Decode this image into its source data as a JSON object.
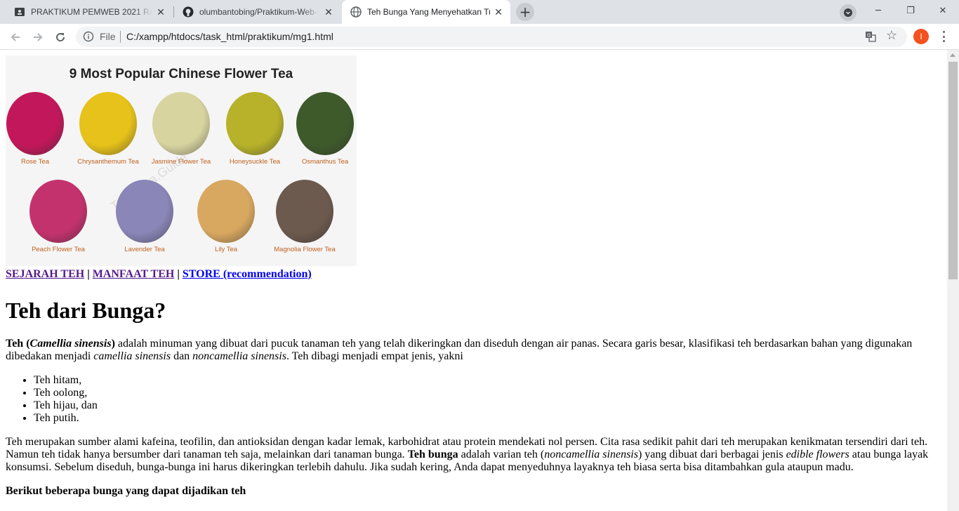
{
  "browser": {
    "tabs": [
      {
        "title": "PRAKTIKUM PEMWEB 2021 RA, R",
        "icon": "classroom-icon"
      },
      {
        "title": "olumbantobing/Praktikum-Web-",
        "icon": "github-icon"
      },
      {
        "title": "Teh Bunga Yang Menyehatkan Tu",
        "icon": "globe-icon"
      }
    ],
    "address": {
      "scheme_label": "File",
      "url": "C:/xampp/htdocs/task_html/praktikum/mg1.html"
    },
    "profile_initial": "I"
  },
  "poster": {
    "title": "9 Most Popular Chinese Flower Tea",
    "watermark": "TeaChina.Guide",
    "teas": [
      {
        "name": "Rose Tea",
        "color": "#c2185b"
      },
      {
        "name": "Chrysanthemum Tea",
        "color": "#e6c21a"
      },
      {
        "name": "Jasmine Flower Tea",
        "color": "#d8d4a0"
      },
      {
        "name": "Honeysuckle Tea",
        "color": "#b8b22a"
      },
      {
        "name": "Osmanthus Tea",
        "color": "#3e5a2a"
      },
      {
        "name": "Peach Flower Tea",
        "color": "#c4326e"
      },
      {
        "name": "Lavender Tea",
        "color": "#8a86b8"
      },
      {
        "name": "Lily Tea",
        "color": "#d9a860"
      },
      {
        "name": "Magnolia Flower Tea",
        "color": "#6d5a4e"
      }
    ]
  },
  "nav": {
    "sejarah": "SEJARAH TEH",
    "manfaat": "MANFAAT TEH",
    "store": "STORE (recommendation)",
    "separator": "|"
  },
  "page": {
    "title": "Teh dari Bunga?",
    "p1": {
      "b_teh": "Teh (",
      "bi_camellia": "Camellia sinensis",
      "b_close": ")",
      "t1": " adalah minuman yang dibuat dari pucuk tanaman teh yang telah dikeringkan dan diseduh dengan air panas. Secara garis besar, klasifikasi teh berdasarkan bahan yang digunakan dibedakan menjadi ",
      "i1": "camellia sinensis",
      "t2": " dan ",
      "i2": "noncamellia sinensis",
      "t3": ". Teh dibagi menjadi empat jenis, yakni"
    },
    "list": [
      "Teh hitam,",
      "Teh oolong,",
      "Teh hijau, dan",
      "Teh putih."
    ],
    "p2": {
      "t1": "Teh merupakan sumber alami kafeina, teofilin, dan antioksidan dengan kadar lemak, karbohidrat atau protein mendekati nol persen. Cita rasa sedikit pahit dari teh merupakan kenikmatan tersendiri dari teh. Namun teh tidak hanya bersumber dari tanaman teh saja, melainkan dari tanaman bunga. ",
      "b1": "Teh bunga",
      "t2": " adalah varian teh (",
      "i1": "noncamellia sinensis",
      "t3": ") yang dibuat dari berbagai jenis ",
      "i2": "edible flowers",
      "t4": " atau bunga layak konsumsi. Sebelum diseduh, bunga-bunga ini harus dikeringkan terlebih dahulu. Jika sudah kering, Anda dapat menyeduhnya layaknya teh biasa serta bisa ditambahkan gula ataupun madu."
    },
    "subheading": "Berikut beberapa bunga yang dapat dijadikan teh"
  }
}
